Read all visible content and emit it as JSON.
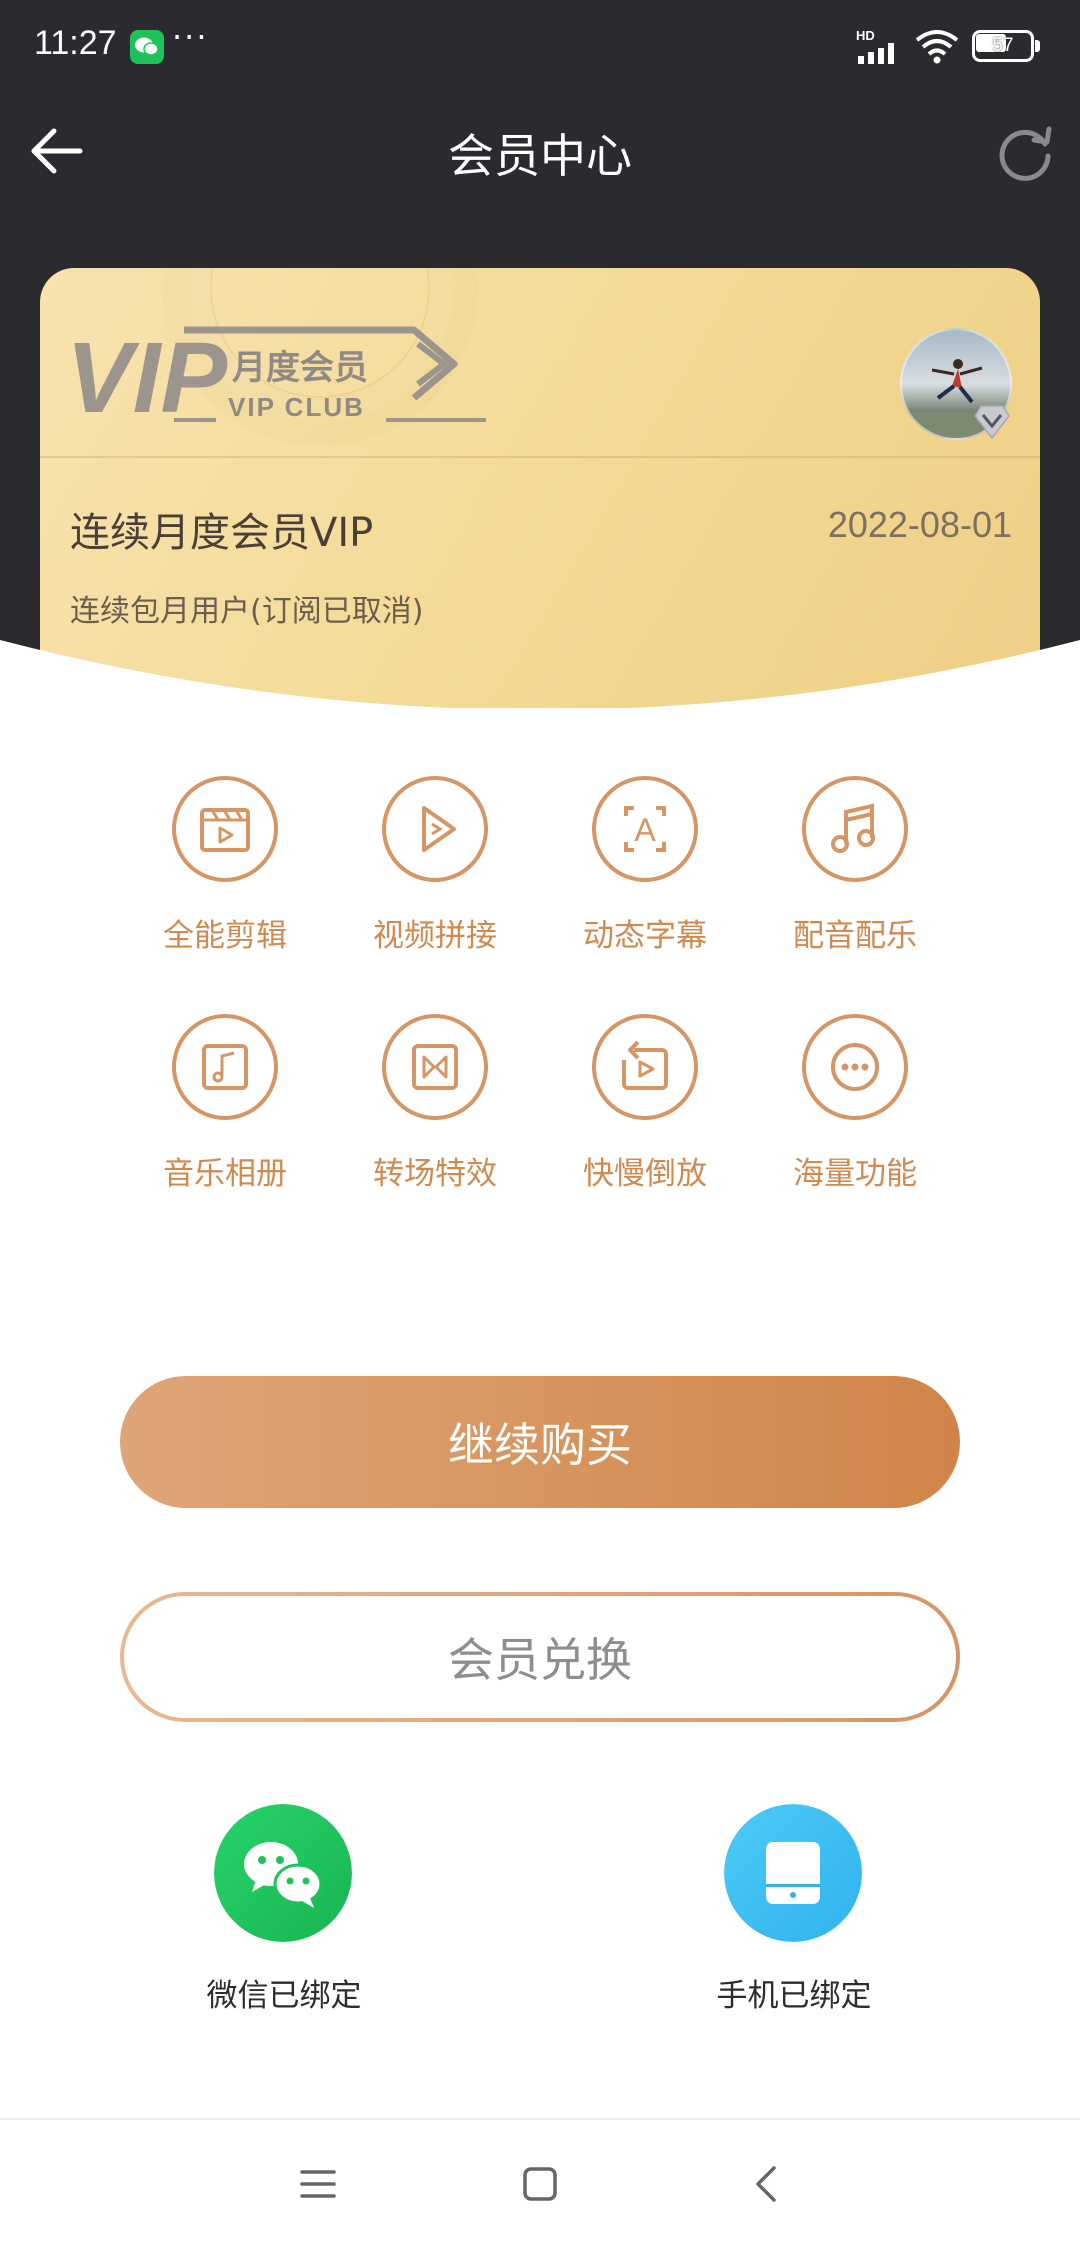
{
  "status_bar": {
    "time": "11:27",
    "overflow": "···",
    "network": "HD",
    "battery_level": "57",
    "icons": [
      "wechat-icon",
      "signal-icon",
      "wifi-icon",
      "battery-icon"
    ]
  },
  "header": {
    "title": "会员中心",
    "back_icon": "arrow-left-icon",
    "refresh_icon": "refresh-icon",
    "background": "#2b2b2f"
  },
  "vip_card": {
    "logo_text": "VIP",
    "membership_type": "月度会员",
    "club_text": "VIP CLUB",
    "plan_name": "连续月度会员VIP",
    "expiry_date": "2022-08-01",
    "status_text": "连续包月用户(订阅已取消)",
    "colors": {
      "gold_light": "#f7e3b0",
      "gold_dark": "#efcf86"
    }
  },
  "features": [
    {
      "label": "全能剪辑",
      "icon": "clapperboard-icon"
    },
    {
      "label": "视频拼接",
      "icon": "play-icon"
    },
    {
      "label": "动态字幕",
      "icon": "text-frame-icon"
    },
    {
      "label": "配音配乐",
      "icon": "music-note-icon"
    },
    {
      "label": "音乐相册",
      "icon": "music-album-icon"
    },
    {
      "label": "转场特效",
      "icon": "transition-icon"
    },
    {
      "label": "快慢倒放",
      "icon": "rewind-icon"
    },
    {
      "label": "海量功能",
      "icon": "more-icon"
    }
  ],
  "actions": {
    "buy_label": "继续购买",
    "redeem_label": "会员兑换",
    "accent": "#d8955f"
  },
  "bindings": [
    {
      "label": "微信已绑定",
      "icon": "wechat-icon",
      "color": "#1fc15b"
    },
    {
      "label": "手机已绑定",
      "icon": "phone-icon",
      "color": "#3fbff2"
    }
  ],
  "system_nav": {
    "icons": [
      "menu-icon",
      "home-icon",
      "back-icon"
    ]
  }
}
